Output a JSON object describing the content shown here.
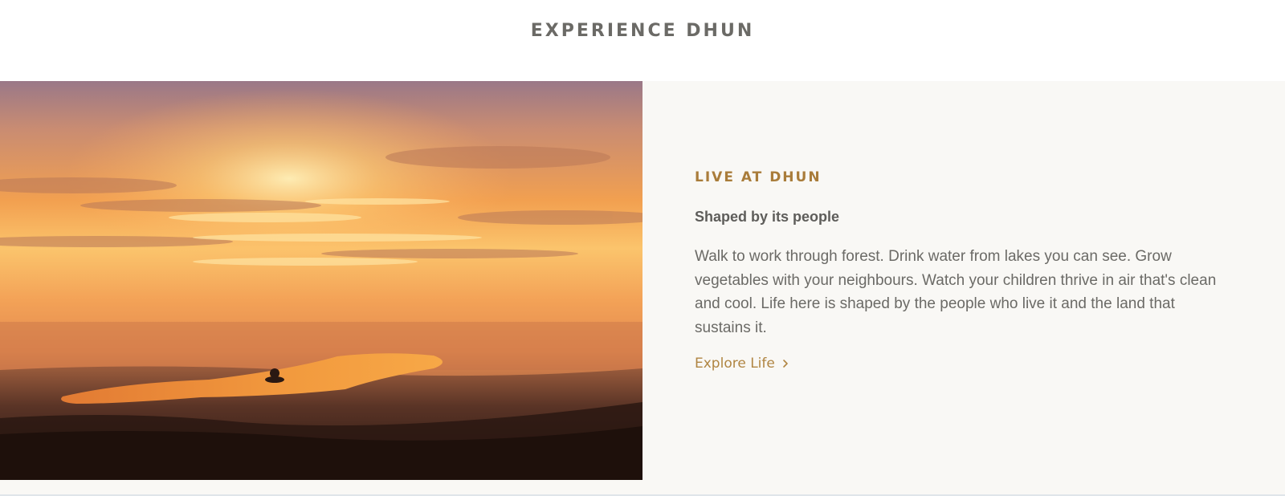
{
  "section": {
    "title": "EXPERIENCE DHUN"
  },
  "feature": {
    "image_subject": "sunset-over-lake-landscape",
    "eyebrow": "LIVE AT DHUN",
    "subhead": "Shaped by its people",
    "body": "Walk to work through forest. Drink water from lakes you can see. Grow vegetables with your neighbours. Watch your children thrive in air that's clean and cool. Life here is shaped by the people who live it and the land that sustains it.",
    "cta_label": "Explore Life",
    "cta_icon": "chevron-right-icon"
  },
  "colors": {
    "accent": "#a97c3a",
    "title_text": "#6b6a66",
    "panel_bg": "#f9f8f5"
  }
}
